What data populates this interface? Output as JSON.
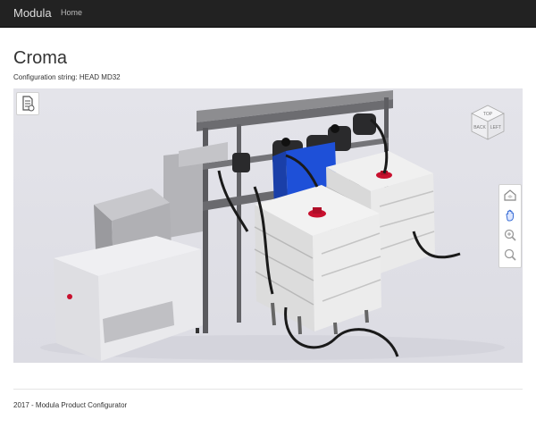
{
  "nav": {
    "brand": "Modula",
    "home": "Home"
  },
  "page": {
    "title": "Croma",
    "config_label": "Configuration string:",
    "config_value": "HEAD MD32"
  },
  "viewer": {
    "cube_faces": [
      "TOP",
      "BACK",
      "LEFT"
    ],
    "icons": [
      "document-icon",
      "home-view-icon",
      "pan-hand-icon",
      "zoom-in-icon",
      "zoom-out-icon"
    ]
  },
  "footer": {
    "text": "2017 - Modula Product Configurator"
  },
  "colors": {
    "navbar": "#222222",
    "viewer_bg": "#e2e2e8",
    "accent_blue": "#1e50d8",
    "cap_red": "#c8102e"
  }
}
